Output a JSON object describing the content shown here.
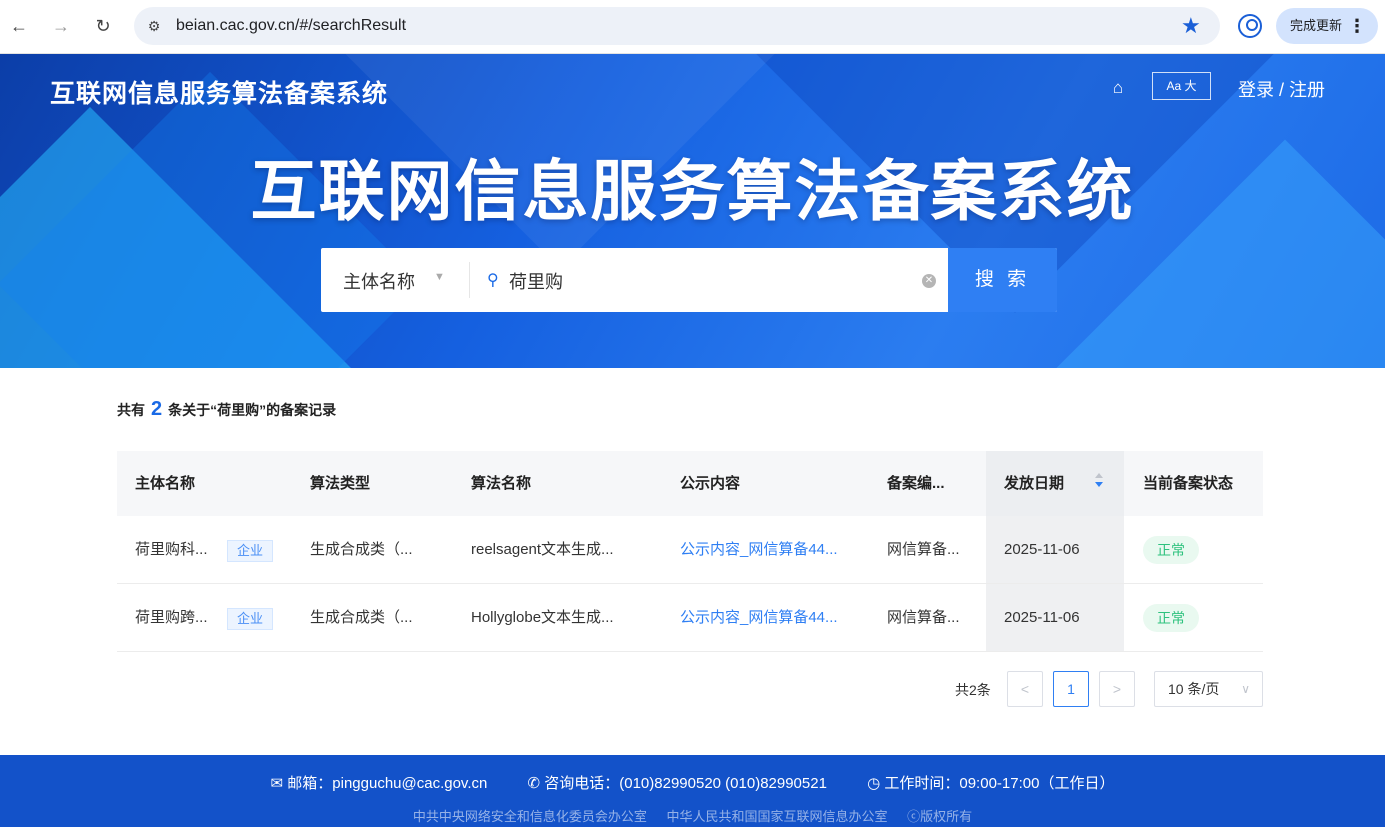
{
  "browser": {
    "url": "beian.cac.gov.cn/#/searchResult",
    "update_label": "完成更新",
    "menu_glyph": "⋮"
  },
  "header": {
    "site_title": "互联网信息服务算法备案系统",
    "font_toggle": "Aa 大",
    "login": "登录 / 注册"
  },
  "hero": {
    "title": "互联网信息服务算法备案系统"
  },
  "search": {
    "type_label": "主体名称",
    "value": "荷里购",
    "button": "搜 索"
  },
  "summary": {
    "prefix": "共有",
    "count": "2",
    "suffix": "条关于“荷里购”的备案记录"
  },
  "table": {
    "headers": [
      "主体名称",
      "算法类型",
      "算法名称",
      "公示内容",
      "备案编...",
      "发放日期",
      "当前备案状态"
    ],
    "rows": [
      {
        "entity": "荷里购科...",
        "tag": "企业",
        "type": "生成合成类（...",
        "name": "reelsagent文本生成...",
        "content": "公示内容_网信算备44...",
        "number": "网信算备...",
        "date": "2025-11-06",
        "status": "正常"
      },
      {
        "entity": "荷里购跨...",
        "tag": "企业",
        "type": "生成合成类（...",
        "name": "Hollyglobe文本生成...",
        "content": "公示内容_网信算备44...",
        "number": "网信算备...",
        "date": "2025-11-06",
        "status": "正常"
      }
    ]
  },
  "pagination": {
    "total": "共2条",
    "prev": "<",
    "current": "1",
    "next": ">",
    "page_size": "10 条/页"
  },
  "footer": {
    "email": "邮箱：pingguchu@cac.gov.cn",
    "phone": "咨询电话：(010)82990520   (010)82990521",
    "hours": "工作时间：09:00-17:00（工作日）",
    "org1": "中共中央网络安全和信息化委员会办公室",
    "org2": "中华人民共和国国家互联网信息办公室",
    "copyright": "ⓒ版权所有"
  },
  "colors": {
    "brand_blue": "#1352c9",
    "accent": "#2f7ff3",
    "status_green": "#2ec27e"
  },
  "icons": [
    "back-icon",
    "forward-icon",
    "reload-icon",
    "site-settings-icon",
    "bookmark-star-icon",
    "profile-icon",
    "home-icon",
    "search-icon",
    "clear-icon",
    "sort-icon",
    "mail-icon",
    "phone-icon",
    "clock-icon"
  ]
}
